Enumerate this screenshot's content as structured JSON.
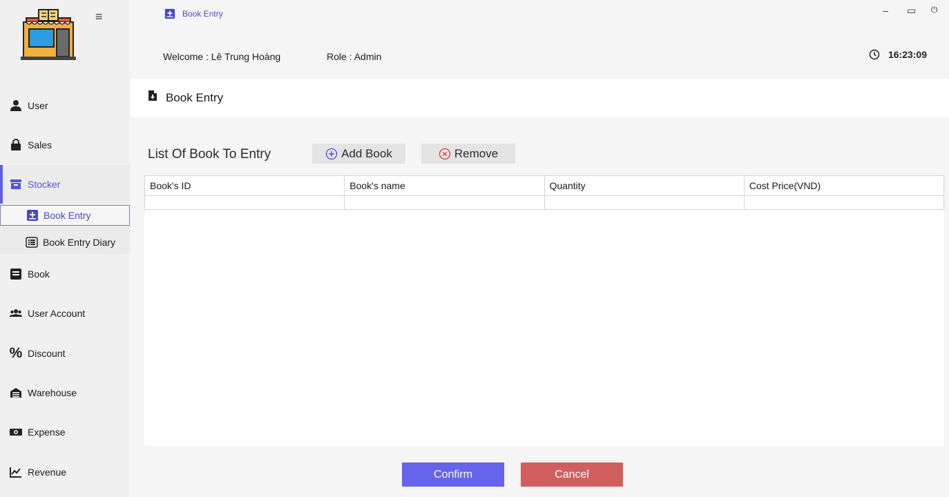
{
  "header": {
    "tab_label": "Book Entry",
    "welcome": "Welcome :  Lê Trung Hoàng",
    "role": "Role : Admin",
    "time": "16:23:09",
    "minimize_symbol": "–",
    "maximize_symbol": "▭",
    "power_symbol": "⏻"
  },
  "sidebar": {
    "menu_symbol": "≡",
    "items": [
      {
        "label": "User",
        "icon": "user-icon"
      },
      {
        "label": "Sales",
        "icon": "shopping-bag-icon"
      },
      {
        "label": "Stocker",
        "icon": "archive-icon"
      },
      {
        "label": "Book",
        "icon": "book-icon"
      },
      {
        "label": "User Account",
        "icon": "users-icon"
      },
      {
        "label": "Discount",
        "icon": "percent-icon"
      },
      {
        "label": "Warehouse",
        "icon": "warehouse-icon"
      },
      {
        "label": "Expense",
        "icon": "money-icon"
      },
      {
        "label": "Revenue",
        "icon": "chart-line-icon"
      }
    ],
    "subitems": [
      {
        "label": "Book Entry",
        "icon": "book-plus-icon"
      },
      {
        "label": "Book Entry Diary",
        "icon": "list-icon"
      }
    ],
    "active_item": "Stocker",
    "active_subitem": "Book Entry"
  },
  "page": {
    "title": "Book Entry"
  },
  "content": {
    "section_title": "List Of Book To Entry",
    "add_label": "Add Book",
    "remove_label": "Remove",
    "table": {
      "columns": [
        "Book's ID",
        "Book's name",
        "Quantity",
        "Cost Price(VND)"
      ],
      "rows": [
        [
          "",
          "",
          "",
          ""
        ]
      ]
    },
    "confirm_label": "Confirm",
    "cancel_label": "Cancel"
  },
  "colors": {
    "accent": "#6464ec",
    "danger": "#d25f5f",
    "sidebar_bg": "#f0f0f0"
  }
}
